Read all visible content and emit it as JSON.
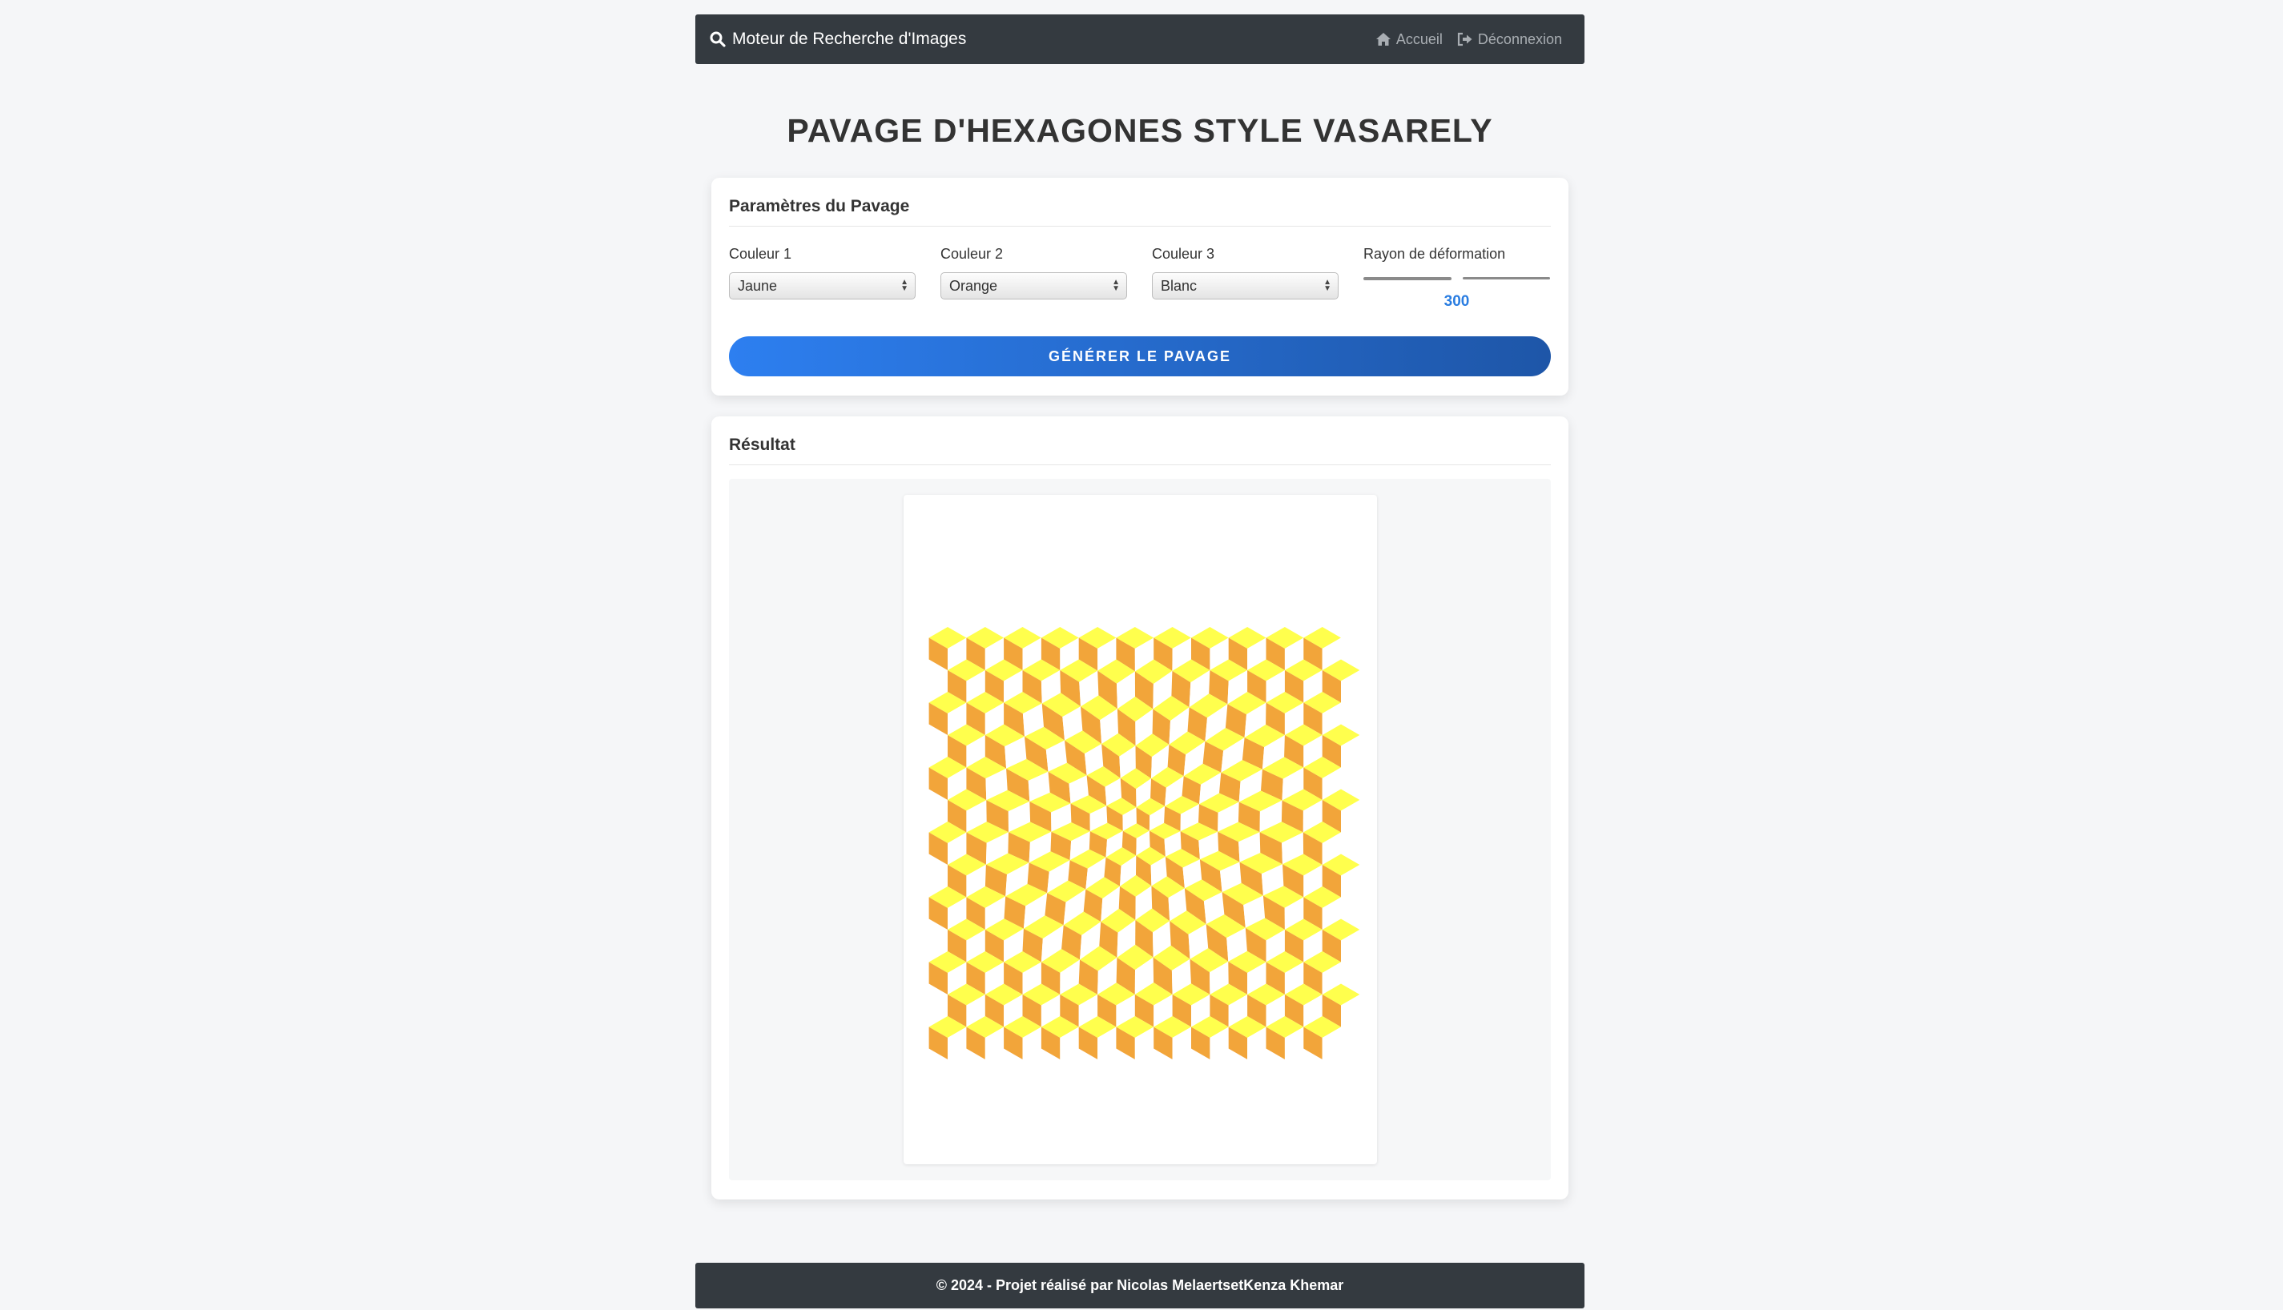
{
  "navbar": {
    "brand": "Moteur de Recherche d'Images",
    "links": [
      {
        "label": "Accueil",
        "icon": "home-icon"
      },
      {
        "label": "Déconnexion",
        "icon": "sign-out-icon"
      }
    ]
  },
  "page": {
    "title": "PAVAGE D'HEXAGONES STYLE VASARELY"
  },
  "params": {
    "title": "Paramètres du Pavage",
    "color1": {
      "label": "Couleur 1",
      "value": "Jaune"
    },
    "color2": {
      "label": "Couleur 2",
      "value": "Orange"
    },
    "color3": {
      "label": "Couleur 3",
      "value": "Blanc"
    },
    "radius": {
      "label": "Rayon de déformation",
      "value": "300"
    },
    "button": "GÉNÉRER LE PAVAGE"
  },
  "result": {
    "title": "Résultat",
    "colors": {
      "top": "#ffff4d",
      "left": "#f2a53a",
      "right": "#ffffff"
    }
  },
  "footer": {
    "prefix": "© 2024 - Projet réalisé par ",
    "author1": "Nicolas Melaerts",
    "conj": " et ",
    "author2": "Kenza Khemar"
  }
}
